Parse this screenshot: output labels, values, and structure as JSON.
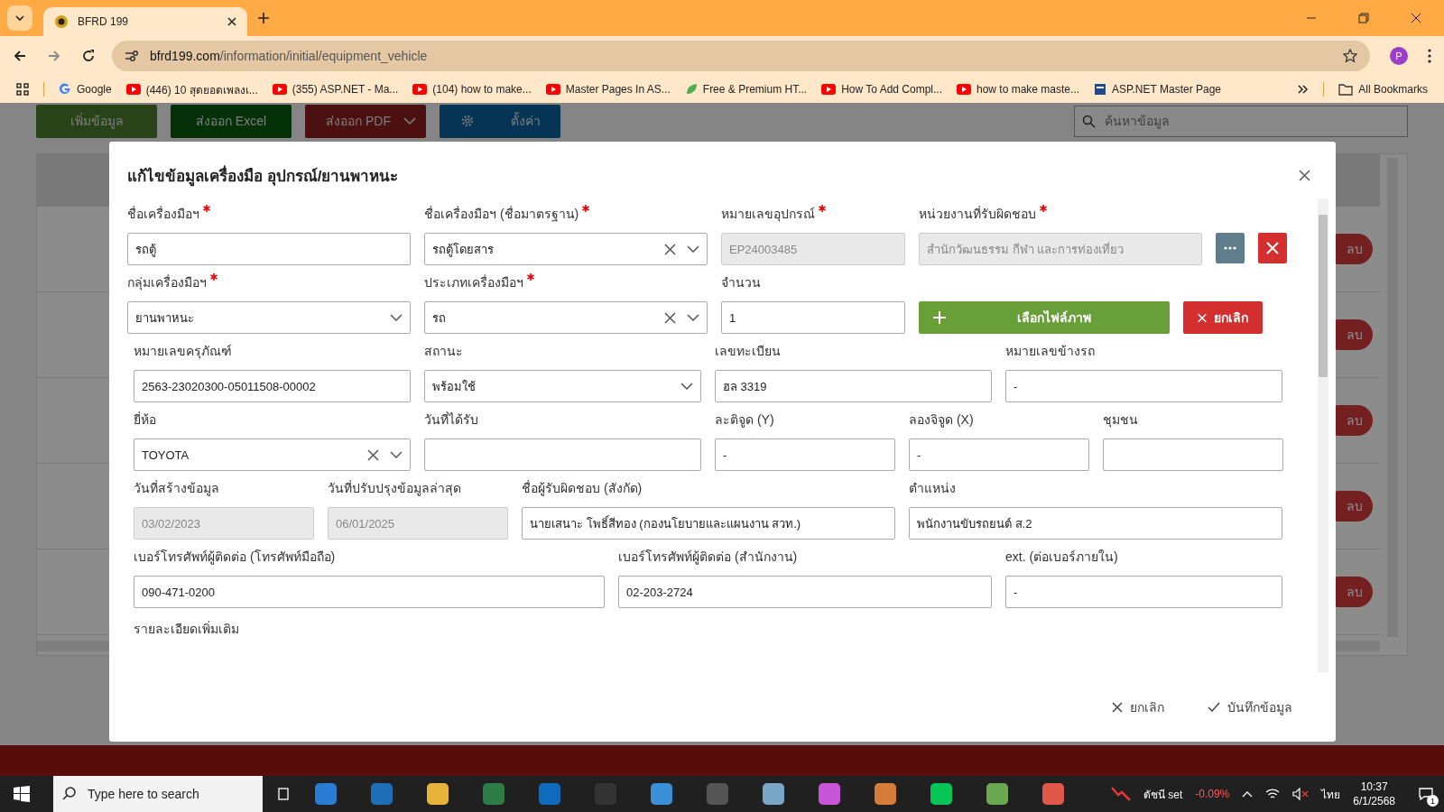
{
  "browser": {
    "tab_title": "BFRD 199",
    "url_host": "bfrd199.com",
    "url_path": "/information/initial/equipment_vehicle",
    "bookmarks": [
      {
        "kind": "google",
        "label": "Google"
      },
      {
        "kind": "video",
        "label": "(446) 10 สุดยอดเพลงเ..."
      },
      {
        "kind": "video",
        "label": "(355) ASP.NET - Ma..."
      },
      {
        "kind": "video",
        "label": "(104) how to make..."
      },
      {
        "kind": "video",
        "label": "Master Pages In AS..."
      },
      {
        "kind": "leaf",
        "label": "Free & Premium HT..."
      },
      {
        "kind": "video",
        "label": "How To Add Compl..."
      },
      {
        "kind": "video",
        "label": "how to make maste..."
      },
      {
        "kind": "doc",
        "label": "ASP.NET Master Page"
      }
    ],
    "all_bookmarks": "All Bookmarks",
    "profile": "P"
  },
  "toolbar": [
    {
      "kind": "add",
      "label": "เพิ่มข้อมูล"
    },
    {
      "kind": "excel",
      "label": "ส่งออก Excel"
    },
    {
      "kind": "pdf",
      "label": "ส่งออก PDF"
    },
    {
      "kind": "settings",
      "label": "ตั้งค่า"
    }
  ],
  "search": {
    "placeholder": "ค้นหาข้อมูล"
  },
  "table_rows": [
    {
      "action": "ลบ"
    },
    {
      "action": "ลบ"
    },
    {
      "action": "ลบ"
    },
    {
      "action": "ลบ"
    },
    {
      "action": "ลบ"
    }
  ],
  "modal": {
    "title": "แก้ไขข้อมูลเครื่องมือ อุปกรณ์/ยานพาหนะ",
    "sections": [
      {
        "fields": [
          {
            "kind": "input",
            "label": "ชื่อเครื่องมือฯ",
            "required": true,
            "value": "รถตู้"
          },
          {
            "kind": "select",
            "label": "ชื่อเครื่องมือฯ (ชื่อมาตรฐาน)",
            "required": true,
            "value": "รถตู้โดยสาร",
            "clearable": true
          },
          {
            "kind": "disabled",
            "label": "หมายเลขอุปกรณ์",
            "required": true,
            "value": "EP24003485"
          },
          {
            "kind": "disabled",
            "label": "หน่วยงานที่รับผิดชอบ",
            "required": true,
            "value": "สำนักวัฒนธรรม กีฬา และการท่องเที่ยว"
          },
          {
            "kind": "more"
          },
          {
            "kind": "remove"
          }
        ]
      },
      {
        "fields": [
          {
            "kind": "select",
            "label": "กลุ่มเครื่องมือฯ",
            "required": true,
            "value": "ยานพาหนะ",
            "clearable": false
          },
          {
            "kind": "select",
            "label": "ประเภทเครื่องมือฯ",
            "required": true,
            "value": "รถ",
            "clearable": true
          },
          {
            "kind": "input",
            "label": "จำนวน",
            "required": false,
            "value": "1"
          },
          {
            "kind": "upload",
            "text": "เลือกไฟล์ภาพ"
          },
          {
            "kind": "cancel",
            "text": "ยกเลิก"
          }
        ]
      },
      {
        "fields": [
          {
            "kind": "input",
            "label": "หมายเลขครุภัณฑ์",
            "required": false,
            "value": "2563-23020300-05011508-00002"
          },
          {
            "kind": "select",
            "label": "สถานะ",
            "required": false,
            "value": "พร้อมใช้",
            "clearable": false
          },
          {
            "kind": "input",
            "label": "เลขทะเบียน",
            "required": false,
            "value": "ฮล 3319"
          },
          {
            "kind": "input",
            "label": "หมายเลขข้างรถ",
            "required": false,
            "value": "-"
          }
        ]
      },
      {
        "fields": [
          {
            "kind": "select",
            "label": "ยี่ห้อ",
            "required": false,
            "value": "TOYOTA",
            "clearable": true
          },
          {
            "kind": "input",
            "label": "วันที่ได้รับ",
            "required": false
          },
          {
            "kind": "input",
            "label": "ละติจูด (Y)",
            "required": false,
            "value": "-"
          },
          {
            "kind": "input",
            "label": "ลองจิจูด (X)",
            "required": false,
            "value": "-"
          },
          {
            "kind": "input",
            "label": "ชุมชน",
            "required": false
          }
        ]
      },
      {
        "fields": [
          {
            "kind": "disabled",
            "label": "วันที่สร้างข้อมูล",
            "required": false,
            "value": "03/02/2023"
          },
          {
            "kind": "disabled",
            "label": "วันที่ปรับปรุงข้อมูลล่าสุด",
            "required": false,
            "value": "06/01/2025"
          },
          {
            "kind": "input",
            "label": "ชื่อผู้รับผิดชอบ (สังกัด)",
            "required": false,
            "value": "นายเสนาะ โพธิ์สีทอง (กองนโยบายและแผนงาน สวท.)"
          },
          {
            "kind": "input",
            "label": "ตำแหน่ง",
            "required": false,
            "value": "พนักงานขับรถยนต์ ส.2"
          }
        ]
      },
      {
        "fields": [
          {
            "kind": "input",
            "label": "เบอร์โทรศัพท์ผู้ติดต่อ (โทรศัพท์มือถือ)",
            "required": false,
            "value": "090-471-0200"
          },
          {
            "kind": "input",
            "label": "เบอร์โทรศัพท์ผู้ติดต่อ (สำนักงาน)",
            "required": false,
            "value": "02-203-2724"
          },
          {
            "kind": "input",
            "label": "ext. (ต่อเบอร์ภายใน)",
            "required": false,
            "value": "-"
          }
        ]
      },
      {
        "fields": [
          {
            "kind": "label",
            "label": "รายละเอียดเพิ่มเติม"
          }
        ]
      }
    ],
    "cancel": "ยกเลิก",
    "save": "บันทึกข้อมูล"
  },
  "taskbar": {
    "search_placeholder": "Type here to search",
    "stock_name": "ดัชนี set",
    "stock_change": "-0.09%",
    "language": "ไทย",
    "time": "10:37",
    "date": "6/1/2568",
    "notifications": "1"
  }
}
